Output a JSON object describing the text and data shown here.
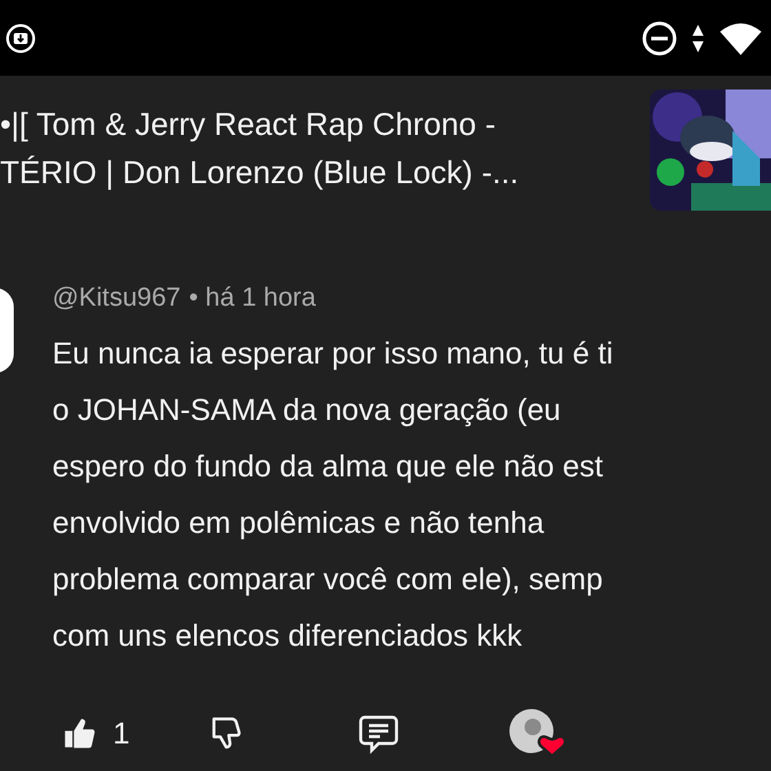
{
  "video": {
    "title_lines": [
      "•|[ Tom & Jerry React Rap Chrono -",
      "TÉRIO | Don Lorenzo (Blue Lock) -..."
    ]
  },
  "comment": {
    "author": "@Kitsu967",
    "time": "• há 1 hora",
    "lines": [
      "Eu nunca ia esperar por isso mano, tu é ti",
      "o JOHAN-SAMA da nova geração (eu",
      "espero do fundo da alma que ele não est",
      "envolvido em polêmicas e não tenha",
      "problema comparar você com ele), semp",
      "com uns elencos diferenciados kkk"
    ],
    "liked": true,
    "like_count": "1",
    "creator_heart": true
  }
}
